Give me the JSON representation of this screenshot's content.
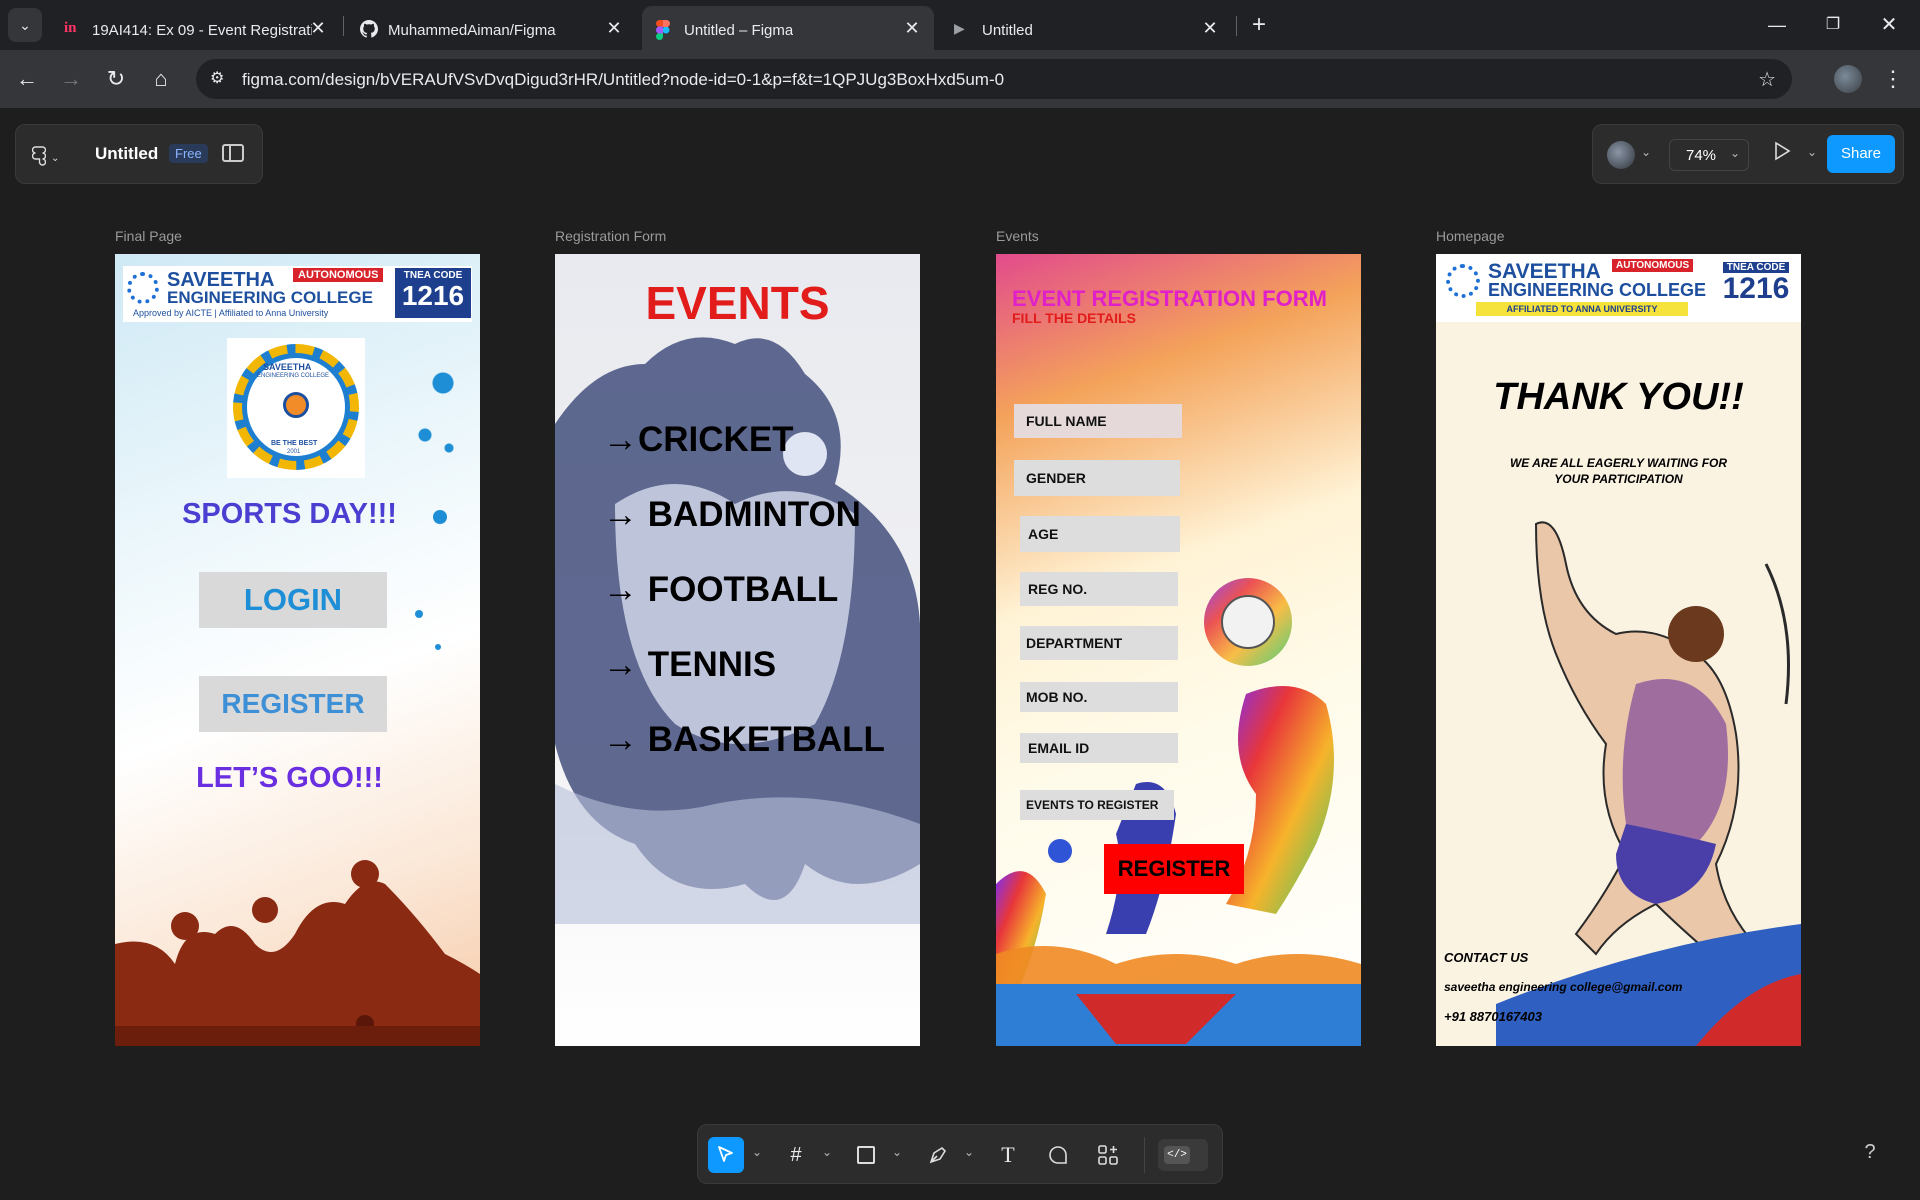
{
  "browser": {
    "tabs": [
      {
        "title": "19AI414: Ex 09 - Event Registrati",
        "active": false
      },
      {
        "title": "MuhammedAiman/Figma",
        "active": false
      },
      {
        "title": "Untitled – Figma",
        "active": true
      },
      {
        "title": "Untitled",
        "active": false
      }
    ],
    "url": "figma.com/design/bVERAUfVSvDvqDigud3rHR/Untitled?node-id=0-1&p=f&t=1QPJUg3BoxHxd5um-0"
  },
  "figma": {
    "file_name": "Untitled",
    "plan_badge": "Free",
    "zoom": "74%",
    "share_label": "Share",
    "help": "?"
  },
  "frames": {
    "final_page": {
      "label": "Final Page",
      "college_name_line1": "SAVEETHA",
      "college_name_line2": "ENGINEERING COLLEGE",
      "autonomous": "AUTONOMOUS",
      "approval": "Approved by AICTE | Affiliated to Anna University",
      "tnea_label": "TNEA CODE",
      "tnea_code": "1216",
      "seal_top": "SAVEETHA",
      "seal_sub": "ENGINEERING COLLEGE",
      "seal_motto": "BE THE BEST",
      "seal_year": "2001",
      "headline": "SPORTS DAY!!!",
      "login_button": "LOGIN",
      "register_button": "REGISTER",
      "tagline": "LET’S GOO!!!"
    },
    "registration_form": {
      "label": "Registration Form",
      "title": "EVENTS",
      "items": [
        "→CRICKET",
        "→ BADMINTON",
        "→ FOOTBALL",
        "→ TENNIS",
        "→ BASKETBALL"
      ]
    },
    "events": {
      "label": "Events",
      "title": "EVENT REGISTRATION FORM",
      "subtitle": "FILL THE DETAILS",
      "fields": [
        "FULL NAME",
        "GENDER",
        "AGE",
        "REG NO.",
        "DEPARTMENT",
        "MOB NO.",
        "EMAIL ID",
        "EVENTS TO REGISTER"
      ],
      "register_button": "REGISTER"
    },
    "homepage": {
      "label": "Homepage",
      "college_name_line1": "SAVEETHA",
      "college_name_line2": "ENGINEERING COLLEGE",
      "autonomous": "AUTONOMOUS",
      "affiliation": "AFFILIATED TO ANNA UNIVERSITY",
      "tnea_label": "TNEA CODE",
      "tnea_code": "1216",
      "thanks": "THANK YOU!!",
      "waiting_line1": "WE ARE ALL EAGERLY WAITING FOR",
      "waiting_line2": "YOUR PARTICIPATION",
      "contact_heading": "CONTACT US",
      "contact_email": "saveetha engineering college@gmail.com",
      "contact_phone": "+91 8870167403"
    }
  }
}
